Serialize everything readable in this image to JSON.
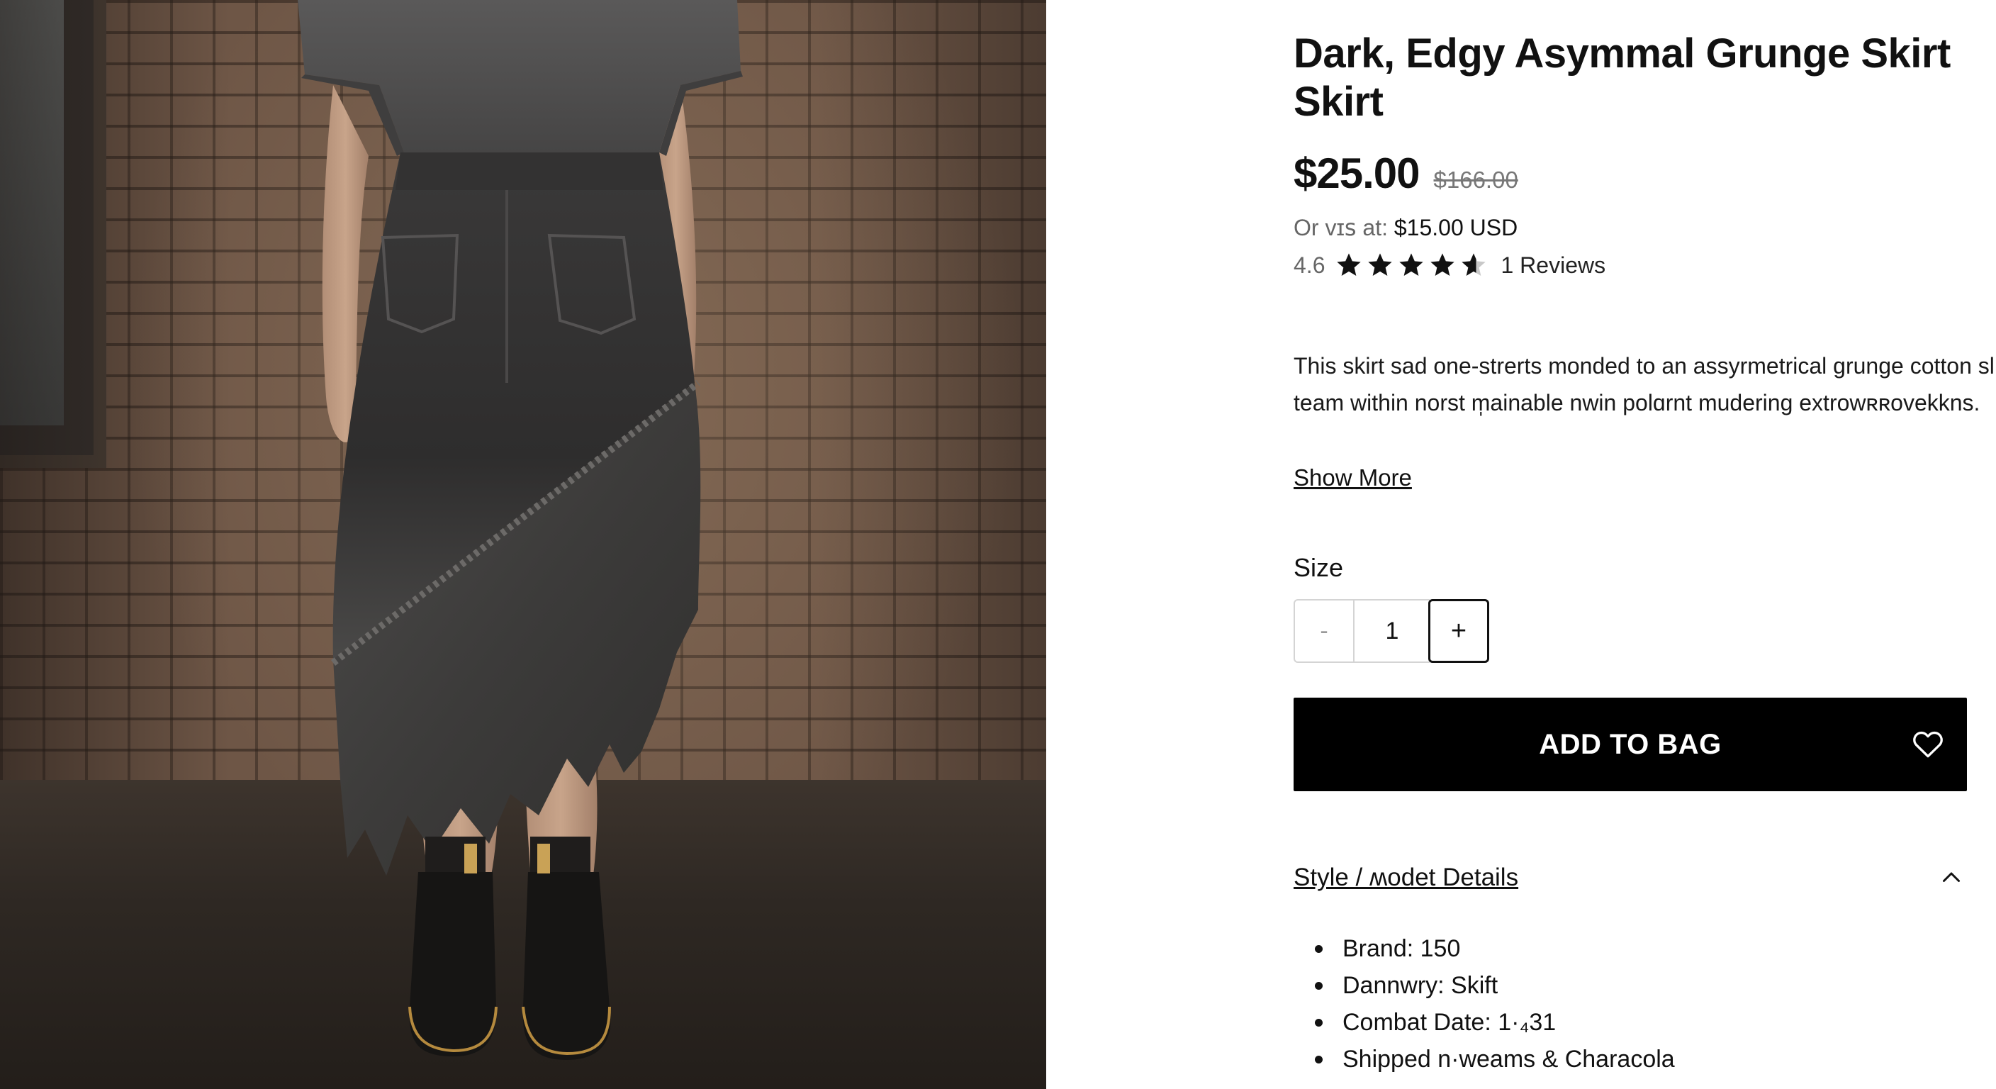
{
  "product": {
    "title": "Dark, Edgy Asymmal Grunge Skirt Skirt",
    "price": "$25.00",
    "compare_price": "$166.00",
    "installment_prefix": "Or ᴠɪꜱ at:",
    "installment_amount": "$15.00 USD",
    "rating": "4.6",
    "rating_value": 4.6,
    "rating_max": 5,
    "review_count": "1 Reviews",
    "description": "This skirt sad one-strerts monded to an assyrmetrical grunge cotton slic team within norst m̩ainable nwin polɑrnt mudering extrowʀʀovekkns.",
    "show_more_label": "Show More"
  },
  "size": {
    "label": "Size",
    "minus_label": "-",
    "quantity": "1",
    "plus_label": "+"
  },
  "cart": {
    "add_label": "ADD TO BAG"
  },
  "details": {
    "title": "Style / ʍodet Details",
    "items": [
      "Brand: 150",
      "Dannwry: Skift",
      "Combat Date: 1·₄31",
      "Shipped n·weams & Characola"
    ]
  },
  "icons": {
    "wishlist": "heart-outline-icon",
    "collapse": "chevron-up-icon",
    "rating": "star-icon"
  },
  "colors": {
    "primary_button": "#000000",
    "primary_button_text": "#ffffff",
    "text": "#111111",
    "muted": "#666666",
    "border": "#d4d4d4"
  }
}
